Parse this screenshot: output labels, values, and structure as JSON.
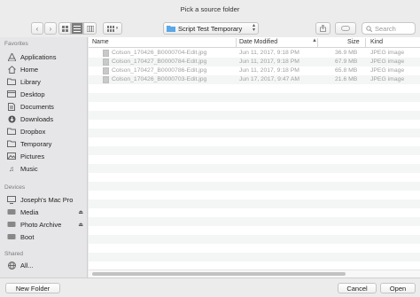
{
  "window": {
    "title": "Pick a source folder"
  },
  "toolbar": {
    "back_icon": "chevron-left-icon",
    "forward_icon": "chevron-right-icon",
    "folder_label": "Script Test Temporary",
    "search_placeholder": "Search"
  },
  "sidebar": {
    "favorites_header": "Favorites",
    "favorites": [
      {
        "label": "Applications",
        "icon": "applications-icon"
      },
      {
        "label": "Home",
        "icon": "home-icon"
      },
      {
        "label": "Library",
        "icon": "folder-icon"
      },
      {
        "label": "Desktop",
        "icon": "desktop-icon"
      },
      {
        "label": "Documents",
        "icon": "documents-icon"
      },
      {
        "label": "Downloads",
        "icon": "downloads-icon"
      },
      {
        "label": "Dropbox",
        "icon": "folder-icon"
      },
      {
        "label": "Temporary",
        "icon": "folder-icon"
      },
      {
        "label": "Pictures",
        "icon": "pictures-icon"
      },
      {
        "label": "Music",
        "icon": "music-icon"
      }
    ],
    "devices_header": "Devices",
    "devices": [
      {
        "label": "Joseph's Mac Pro",
        "icon": "computer-icon"
      },
      {
        "label": "Media",
        "icon": "drive-icon"
      },
      {
        "label": "Photo Archive",
        "icon": "drive-icon"
      },
      {
        "label": "Boot",
        "icon": "drive-icon"
      }
    ],
    "shared_header": "Shared",
    "shared": [
      {
        "label": "All...",
        "icon": "network-icon"
      }
    ]
  },
  "columns": {
    "name": "Name",
    "date": "Date Modified",
    "size": "Size",
    "kind": "Kind"
  },
  "files": [
    {
      "name": "Colson_170426_B0000704-Edit.jpg",
      "date": "Jun 11, 2017, 9:18 PM",
      "size": "36.9 MB",
      "kind": "JPEG image"
    },
    {
      "name": "Colson_170427_B0000784-Edit.jpg",
      "date": "Jun 11, 2017, 9:18 PM",
      "size": "67.9 MB",
      "kind": "JPEG image"
    },
    {
      "name": "Colson_170427_B0000786-Edit.jpg",
      "date": "Jun 11, 2017, 9:18 PM",
      "size": "65.8 MB",
      "kind": "JPEG image"
    },
    {
      "name": "Colson_170426_B0000703-Edit.jpg",
      "date": "Jun 17, 2017, 9:47 AM",
      "size": "21.6 MB",
      "kind": "JPEG image"
    }
  ],
  "buttons": {
    "new_folder": "New Folder",
    "cancel": "Cancel",
    "open": "Open"
  },
  "colors": {
    "folder_blue": "#5ba8e8",
    "accent": "#4a8ee8"
  }
}
